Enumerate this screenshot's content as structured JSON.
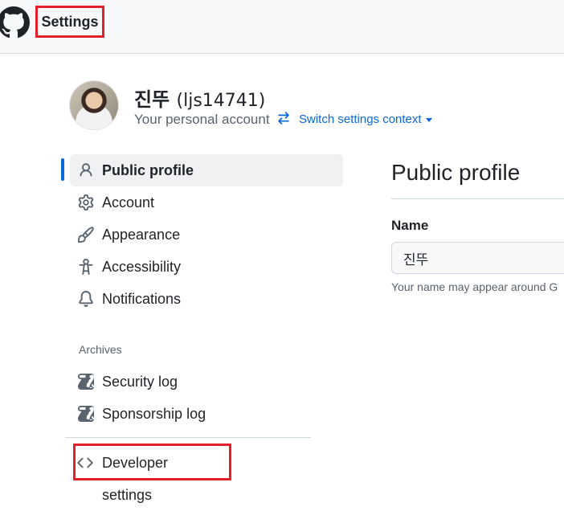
{
  "header": {
    "title": "Settings"
  },
  "profile": {
    "display_name": "진뚜",
    "login": "(ljs14741)",
    "account_type": "Your personal account",
    "switch_label": "Switch settings context"
  },
  "sidebar": {
    "items": [
      {
        "label": "Public profile",
        "icon": "person-icon"
      },
      {
        "label": "Account",
        "icon": "gear-icon"
      },
      {
        "label": "Appearance",
        "icon": "paintbrush-icon"
      },
      {
        "label": "Accessibility",
        "icon": "accessibility-icon"
      },
      {
        "label": "Notifications",
        "icon": "bell-icon"
      }
    ],
    "archives_heading": "Archives",
    "archive_items": [
      {
        "label": "Security log",
        "icon": "log-icon"
      },
      {
        "label": "Sponsorship log",
        "icon": "log-icon"
      }
    ],
    "developer_settings": {
      "label": "Developer settings",
      "icon": "code-icon"
    }
  },
  "main": {
    "title": "Public profile",
    "name_field": {
      "label": "Name",
      "value": "진뚜",
      "note": "Your name may appear around G"
    }
  },
  "colors": {
    "accent": "#0969da",
    "highlight": "#e3202a"
  }
}
